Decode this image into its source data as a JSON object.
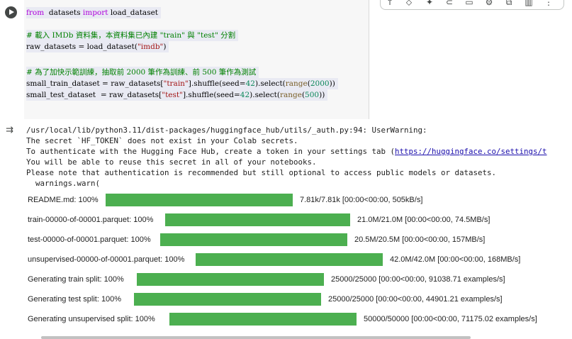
{
  "code": {
    "lines": [
      {
        "parts": [
          [
            "kw",
            "from"
          ],
          [
            "",
            "  datasets "
          ],
          [
            "kw",
            "import"
          ],
          [
            "",
            " load_dataset"
          ]
        ]
      },
      {
        "parts": []
      },
      {
        "parts": [
          [
            "cm",
            "# 載入 IMDb 資料集，本資料集已內建 \"train\" 與 \"test\" 分割"
          ]
        ]
      },
      {
        "parts": [
          [
            "",
            "raw_datasets = load_dataset("
          ],
          [
            "str",
            "\"imdb\""
          ],
          [
            "",
            ")"
          ]
        ]
      },
      {
        "parts": []
      },
      {
        "parts": [
          [
            "cm",
            "# 為了加快示範訓練，抽取前 2000 筆作為訓練、前 500 筆作為測試"
          ]
        ]
      },
      {
        "parts": [
          [
            "",
            "small_train_dataset = raw_datasets["
          ],
          [
            "str",
            "\"train\""
          ],
          [
            "",
            "].shuffle(seed="
          ],
          [
            "num",
            "42"
          ],
          [
            "",
            ").select("
          ],
          [
            "fn",
            "range"
          ],
          [
            "",
            "("
          ],
          [
            "num",
            "2000"
          ],
          [
            "",
            "))"
          ]
        ]
      },
      {
        "parts": [
          [
            "",
            "small_test_dataset  = raw_datasets["
          ],
          [
            "str",
            "\"test\""
          ],
          [
            "",
            "].shuffle(seed="
          ],
          [
            "num",
            "42"
          ],
          [
            "",
            ").select("
          ],
          [
            "fn",
            "range"
          ],
          [
            "",
            "("
          ],
          [
            "num",
            "500"
          ],
          [
            "",
            "))"
          ]
        ]
      }
    ]
  },
  "toolbar": {
    "icons": [
      "arrow-up-icon",
      "arrow-down-icon",
      "sparkle-icon",
      "link-icon",
      "comment-icon",
      "gear-icon",
      "mirror-icon",
      "delete-icon",
      "more-icon"
    ]
  },
  "output": {
    "stderr": [
      "/usr/local/lib/python3.11/dist-packages/huggingface_hub/utils/_auth.py:94: UserWarning: ",
      "The secret `HF_TOKEN` does not exist in your Colab secrets.",
      "To authenticate with the Hugging Face Hub, create a token in your settings tab (",
      "You will be able to reuse this secret in all of your notebooks.",
      "Please note that authentication is recommended but still optional to access public models or datasets.",
      "  warnings.warn("
    ],
    "auth_link": "https://huggingface.co/settings/t",
    "progress": [
      {
        "label": "README.md: 100%",
        "stats": "7.81k/7.81k [00:00<00:00, 505kB/s]",
        "fraction": 1.0
      },
      {
        "label": "train-00000-of-00001.parquet: 100%",
        "stats": "21.0M/21.0M [00:00<00:00, 74.5MB/s]",
        "fraction": 1.0
      },
      {
        "label": "test-00000-of-00001.parquet: 100%",
        "stats": "20.5M/20.5M [00:00<00:00, 157MB/s]",
        "fraction": 1.0
      },
      {
        "label": "unsupervised-00000-of-00001.parquet: 100%",
        "stats": "42.0M/42.0M [00:00<00:00, 168MB/s]",
        "fraction": 1.0
      },
      {
        "label": "Generating train split: 100%",
        "stats": "25000/25000 [00:00<00:00, 91038.71 examples/s]",
        "fraction": 1.0
      },
      {
        "label": "Generating test split: 100%",
        "stats": "25000/25000 [00:00<00:00, 44901.21 examples/s]",
        "fraction": 1.0
      },
      {
        "label": "Generating unsupervised split: 100%",
        "stats": "50000/50000 [00:00<00:00, 71175.02 examples/s]",
        "fraction": 1.0
      }
    ],
    "colors": {
      "progress": "#4caf50"
    }
  }
}
